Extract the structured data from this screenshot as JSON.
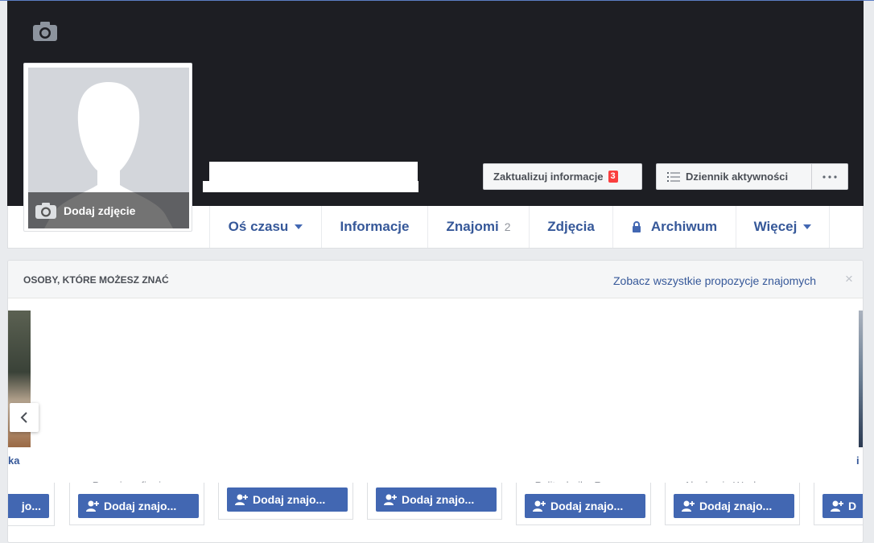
{
  "profile": {
    "add_photo_label": "Dodaj zdjęcie"
  },
  "actions": {
    "update_info_label": "Zaktualizuj informacje",
    "update_info_badge": "3",
    "activity_log_label": "Dziennik aktywności",
    "more_icon": "ellipsis-icon"
  },
  "tabs": [
    {
      "label": "Oś czasu",
      "dropdown": true
    },
    {
      "label": "Informacje"
    },
    {
      "label": "Znajomi",
      "count": "2"
    },
    {
      "label": "Zdjęcia"
    },
    {
      "label": "Archiwum",
      "icon": "lock-icon"
    },
    {
      "label": "Więcej",
      "dropdown": true
    }
  ],
  "pymk": {
    "title": "OSOBY, KTÓRE MOŻESZ ZNAĆ",
    "see_all_link": "Zobacz wszystkie propozycje znajomych",
    "close_label": "×",
    "left_partial_name": "ka",
    "right_partial_name": "i",
    "card_subtitles": [
      "Pracuje w firmie: ...",
      "",
      "",
      "Politechnika Rzesz...",
      "Akademia Wychow..."
    ],
    "add_friend_label": "Dodaj znajo...",
    "left_partial_add": "jo...",
    "right_partial_add": "D"
  },
  "colors": {
    "cover": "#1d1e23",
    "link": "#365899",
    "button_blue": "#4267b2",
    "badge_red": "#fa3e3e"
  }
}
